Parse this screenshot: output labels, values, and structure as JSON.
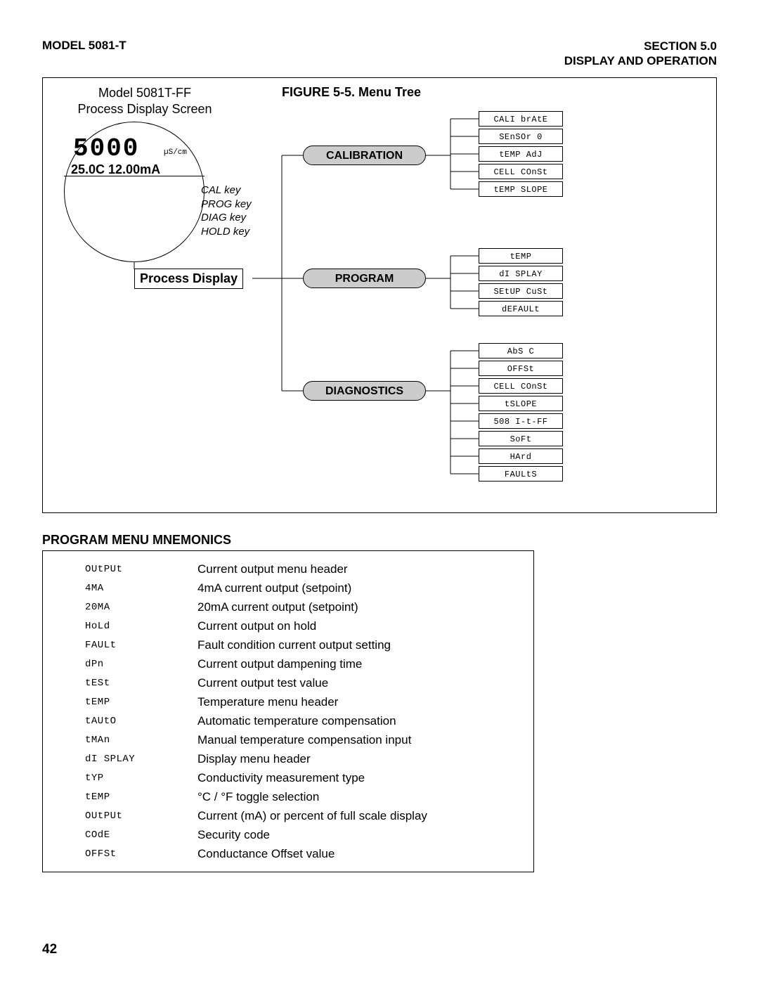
{
  "header": {
    "left": "MODEL 5081-T",
    "right_line1": "SECTION 5.0",
    "right_line2": "DISPLAY AND OPERATION"
  },
  "figure": {
    "title": "FIGURE 5-5. Menu Tree",
    "model_line1": "Model 5081T-FF",
    "model_line2": "Process Display Screen",
    "disp_main": "5000",
    "disp_unit": "µS/cm",
    "disp_sub": "25.0C 12.00mA",
    "keys": [
      "CAL key",
      "PROG key",
      "DIAG key",
      "HOLD key"
    ],
    "process_display": "Process Display",
    "menus": {
      "calibration": {
        "label": "CALIBRATION",
        "items": [
          "CALI brAtE",
          "SEnSOr 0",
          "tEMP AdJ",
          "CELL COnSt",
          "tEMP SLOPE"
        ]
      },
      "program": {
        "label": "PROGRAM",
        "items": [
          "tEMP",
          "dI SPLAY",
          "SEtUP CuSt",
          "dEFAULt"
        ]
      },
      "diagnostics": {
        "label": "DIAGNOSTICS",
        "items": [
          "AbS C",
          "OFFSt",
          "CELL COnSt",
          "tSLOPE",
          "508 I-t-FF",
          "SoFt",
          "HArd",
          "FAULtS"
        ]
      }
    }
  },
  "mnemonics": {
    "title": "PROGRAM MENU MNEMONICS",
    "rows": [
      {
        "code": "OUtPUt",
        "desc": "Current output menu header"
      },
      {
        "code": "4MA",
        "desc": "4mA current output (setpoint)"
      },
      {
        "code": "20MA",
        "desc": "20mA current output (setpoint)"
      },
      {
        "code": "HoLd",
        "desc": "Current output on hold"
      },
      {
        "code": "FAULt",
        "desc": "Fault condition current output setting"
      },
      {
        "code": "dPn",
        "desc": "Current output dampening time"
      },
      {
        "code": "tESt",
        "desc": "Current output test value"
      },
      {
        "code": "tEMP",
        "desc": "Temperature menu header"
      },
      {
        "code": "tAUtO",
        "desc": "Automatic temperature compensation"
      },
      {
        "code": "tMAn",
        "desc": "Manual temperature compensation input"
      },
      {
        "code": "dI SPLAY",
        "desc": "Display menu header"
      },
      {
        "code": "tYP",
        "desc": "Conductivity measurement type"
      },
      {
        "code": "tEMP",
        "desc": "°C / °F toggle selection"
      },
      {
        "code": "OUtPUt",
        "desc": "Current (mA) or percent of full scale display"
      },
      {
        "code": "COdE",
        "desc": "Security code"
      },
      {
        "code": "OFFSt",
        "desc": "Conductance Offset value"
      }
    ]
  },
  "page_number": "42"
}
